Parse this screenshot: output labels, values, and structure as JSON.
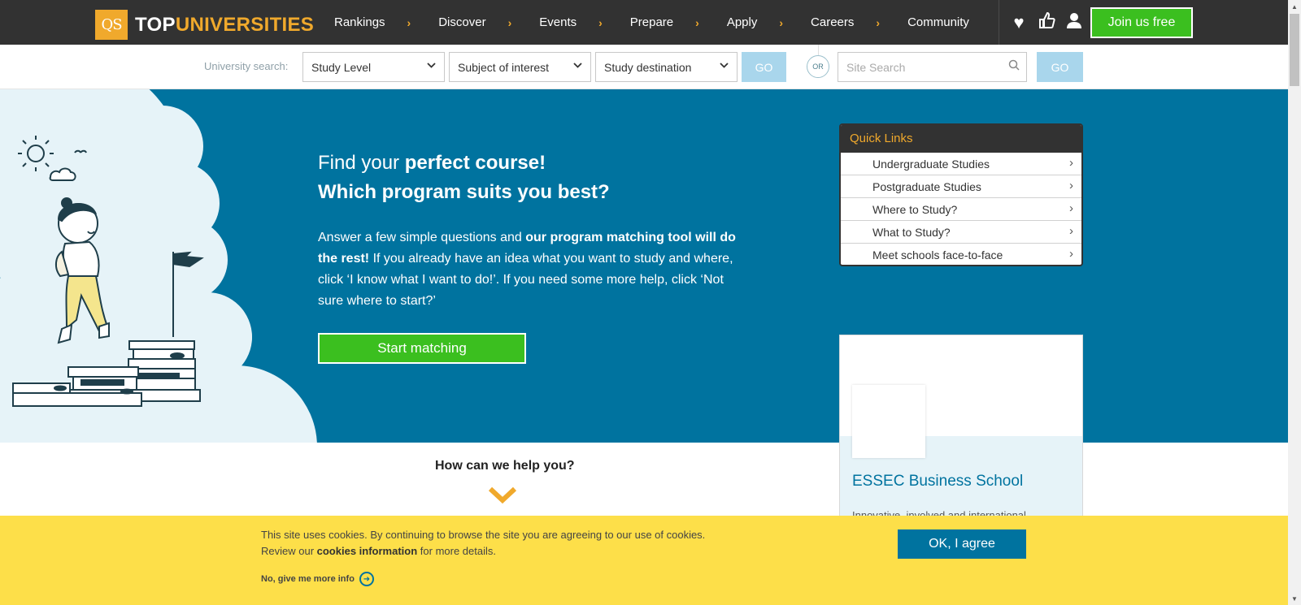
{
  "header": {
    "logo_box": "QS",
    "logo_part1": "TOP",
    "logo_part2": "UNIVERSITIES",
    "nav": [
      "Rankings",
      "Discover",
      "Events",
      "Prepare",
      "Apply",
      "Careers",
      "Community"
    ],
    "join_label": "Join us free"
  },
  "search": {
    "label": "University search:",
    "study_level": "Study Level",
    "subject": "Subject of interest",
    "destination": "Study destination",
    "go_label": "GO",
    "or_label": "OR",
    "site_search_placeholder": "Site Search",
    "site_go_label": "GO"
  },
  "hero": {
    "title_line1_normal": "Find your ",
    "title_line1_bold": "perfect course!",
    "title_line2": "Which program suits you best?",
    "text_part1": "Answer a few simple questions and ",
    "text_bold": "our program matching tool will do the rest!",
    "text_part2": " If you already have an idea what you want to study and where, click ‘I know what I want to do!’. If you need some more help, click ‘Not sure where to start?’",
    "button": "Start matching"
  },
  "quick_links": {
    "title": "Quick Links",
    "items": [
      "Undergraduate Studies",
      "Postgraduate Studies",
      "Where to Study?",
      "What to Study?",
      "Meet schools face-to-face"
    ]
  },
  "ad": {
    "title": "ESSEC Business School",
    "subtitle": "Innovative, involved and international..."
  },
  "help": {
    "label": "How can we help you?"
  },
  "cookie": {
    "line1": "This site uses cookies. By continuing to browse the site you are agreeing to our use of cookies.",
    "line2_pre": "Review our ",
    "line2_link": "cookies information",
    "line2_post": " for more details.",
    "more": "No, give me more info",
    "ok": "OK, I agree"
  },
  "colors": {
    "nav_bg": "#323232",
    "accent_orange": "#f0a92c",
    "green": "#3bbf1f",
    "hero_blue": "#00739f",
    "cookie_yellow": "#fddf49"
  }
}
